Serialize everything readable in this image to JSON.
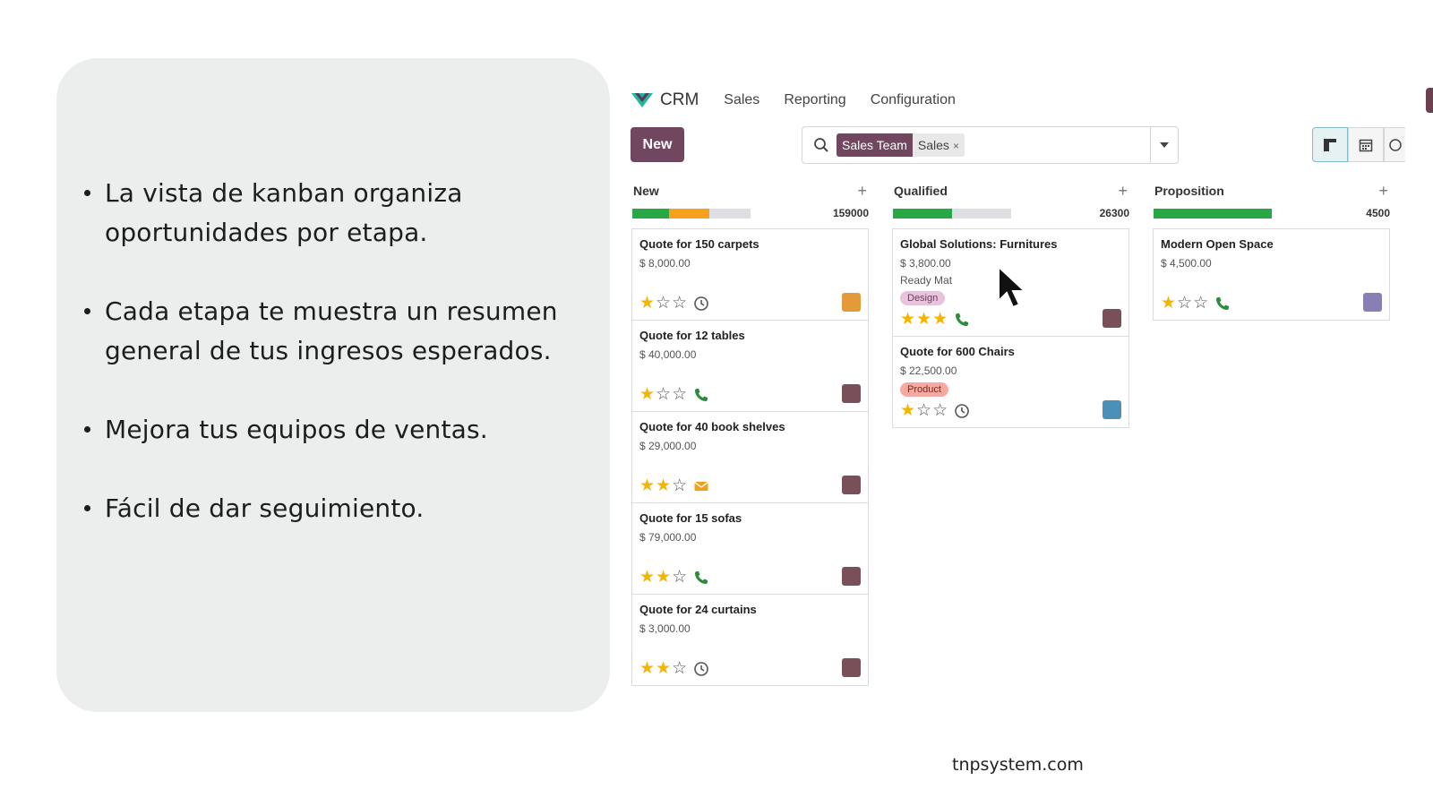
{
  "slide": {
    "bullets": [
      "La vista de kanban organiza oportunidades por etapa.",
      "Cada etapa te muestra un resumen general de tus ingresos esperados.",
      "Mejora tus equipos de ventas.",
      "Fácil de dar seguimiento."
    ],
    "footer": "tnpsystem.com"
  },
  "crm": {
    "app_name": "CRM",
    "menu": [
      "Sales",
      "Reporting",
      "Configuration"
    ],
    "new_button": "New",
    "search": {
      "facet_label": "Sales Team",
      "facet_value": "Sales",
      "facet_close": "×"
    },
    "columns": [
      {
        "title": "New",
        "add": "+",
        "total": "159000",
        "progress": {
          "green": 0.31,
          "orange": 0.34
        },
        "cards": [
          {
            "title": "Quote for 150 carpets",
            "amount": "$ 8,000.00",
            "stars": 1,
            "activity": "clock",
            "avatar_color": "#e59a3a"
          },
          {
            "title": "Quote for 12 tables",
            "amount": "$ 40,000.00",
            "stars": 1,
            "activity": "phone",
            "avatar_color": "#7a5058"
          },
          {
            "title": "Quote for 40 book shelves",
            "amount": "$ 29,000.00",
            "stars": 2,
            "activity": "email",
            "avatar_color": "#7a5058"
          },
          {
            "title": "Quote for 15 sofas",
            "amount": "$ 79,000.00",
            "stars": 2,
            "activity": "phone",
            "avatar_color": "#7a5058"
          },
          {
            "title": "Quote for 24 curtains",
            "amount": "$ 3,000.00",
            "stars": 2,
            "activity": "clock",
            "avatar_color": "#7a5058"
          }
        ]
      },
      {
        "title": "Qualified",
        "add": "+",
        "total": "26300",
        "progress": {
          "green": 0.5,
          "orange": 0
        },
        "cards": [
          {
            "title": "Global Solutions: Furnitures",
            "amount": "$ 3,800.00",
            "company": "Ready Mat",
            "tag": "Design",
            "tag_bg": "#e9c3dc",
            "tag_fg": "#6d3a5c",
            "stars": 3,
            "activity": "phone",
            "avatar_color": "#7a5058"
          },
          {
            "title": "Quote for 600 Chairs",
            "amount": "$ 22,500.00",
            "tag": "Product",
            "tag_bg": "#f6a9a0",
            "tag_fg": "#7a2a22",
            "stars": 1,
            "activity": "clock",
            "avatar_color": "#4a90b8"
          }
        ]
      },
      {
        "title": "Proposition",
        "add": "+",
        "total": "4500",
        "progress": {
          "green": 1.0,
          "orange": 0
        },
        "cards": [
          {
            "title": "Modern Open Space",
            "amount": "$ 4,500.00",
            "stars": 1,
            "activity": "phone",
            "avatar_color": "#8a7fb5"
          }
        ]
      }
    ],
    "colors": {
      "brand": "#71475f",
      "progress_green": "#28a745",
      "progress_orange": "#f7a11a",
      "star": "#f3b500",
      "phone": "#2e8b3a"
    }
  }
}
